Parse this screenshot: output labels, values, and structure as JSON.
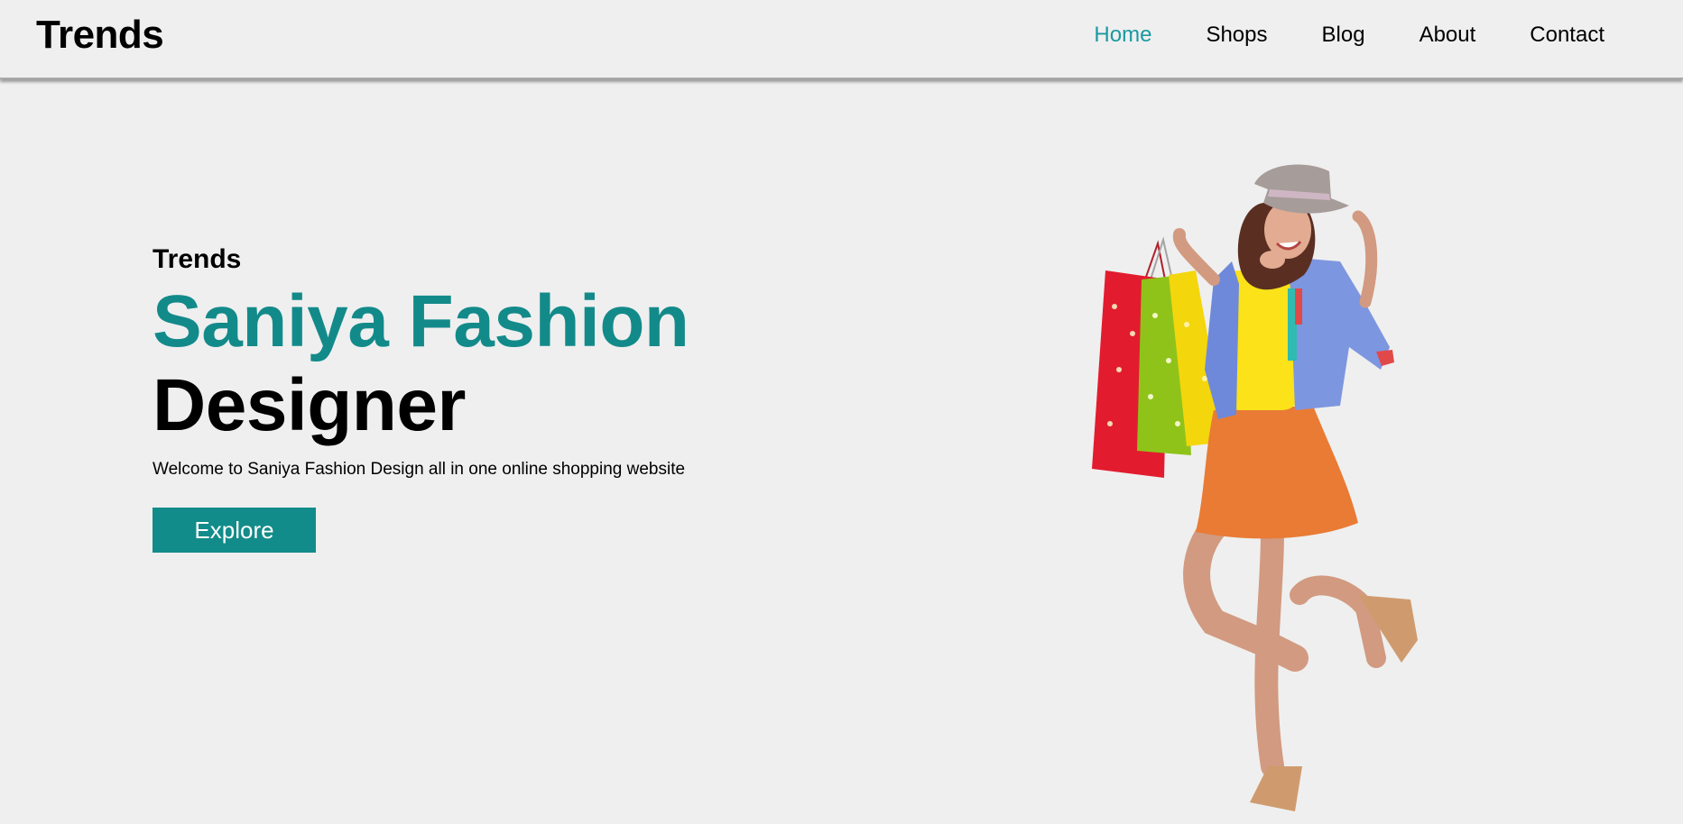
{
  "brand": {
    "name": "Trends"
  },
  "nav": {
    "items": [
      {
        "label": "Home",
        "active": true
      },
      {
        "label": "Shops",
        "active": false
      },
      {
        "label": "Blog",
        "active": false
      },
      {
        "label": "About",
        "active": false
      },
      {
        "label": "Contact",
        "active": false
      }
    ]
  },
  "hero": {
    "eyebrow": "Trends",
    "headline_line1": "Saniya Fashion",
    "headline_line2": "Designer",
    "tagline": "Welcome to Saniya Fashion Design all in one online shopping website",
    "cta_label": "Explore"
  },
  "colors": {
    "background": "#efefef",
    "accent": "#138a8a",
    "nav_active": "#1a9aa0",
    "button_bg": "#118c8a",
    "button_text": "#ffffff"
  }
}
